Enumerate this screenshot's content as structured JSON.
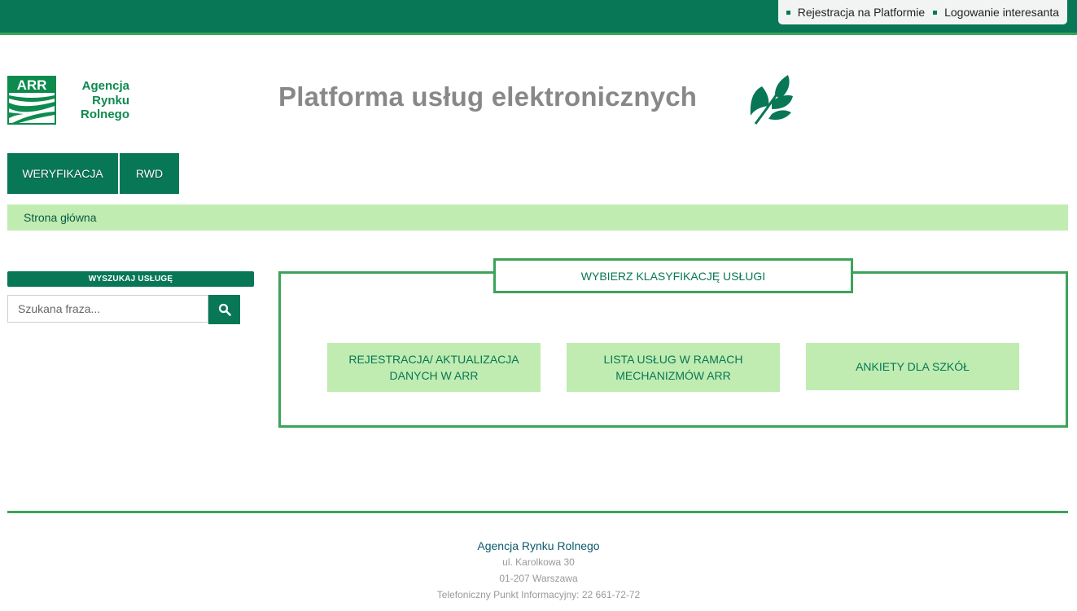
{
  "topbar": {
    "links": [
      {
        "label": "Rejestracja na Platformie"
      },
      {
        "label": "Logowanie interesanta"
      }
    ]
  },
  "logo": {
    "abbr": "ARR",
    "name_line1": "Agencja",
    "name_line2": "Rynku",
    "name_line3": "Rolnego"
  },
  "header": {
    "title": "Platforma usług elektronicznych"
  },
  "nav": {
    "items": [
      {
        "label": "WERYFIKACJA"
      },
      {
        "label": "RWD"
      }
    ]
  },
  "breadcrumb": {
    "current": "Strona główna"
  },
  "search": {
    "title": "WYSZUKAJ USŁUGĘ",
    "placeholder": "Szukana fraza...",
    "value": ""
  },
  "classification": {
    "title": "WYBIERZ KLASYFIKACJĘ USŁUGI",
    "tiles": [
      {
        "line1": "REJESTRACJA/ AKTUALIZACJA",
        "line2": "DANYCH W ARR"
      },
      {
        "line1": "LISTA USŁUG W RAMACH",
        "line2": "MECHANIZMÓW ARR"
      },
      {
        "line1": "ANKIETY DLA SZKÓŁ",
        "line2": ""
      }
    ]
  },
  "footer": {
    "org": "Agencja Rynku Rolnego",
    "street": "ul. Karolkowa 30",
    "city": "01-207 Warszawa",
    "phone": "Telefoniczny Punkt Informacyjny: 22 661-72-72"
  },
  "colors": {
    "primary": "#087755",
    "accent_line": "#3da35a",
    "light_green": "#c0ecb1",
    "title_gray": "#888888"
  }
}
